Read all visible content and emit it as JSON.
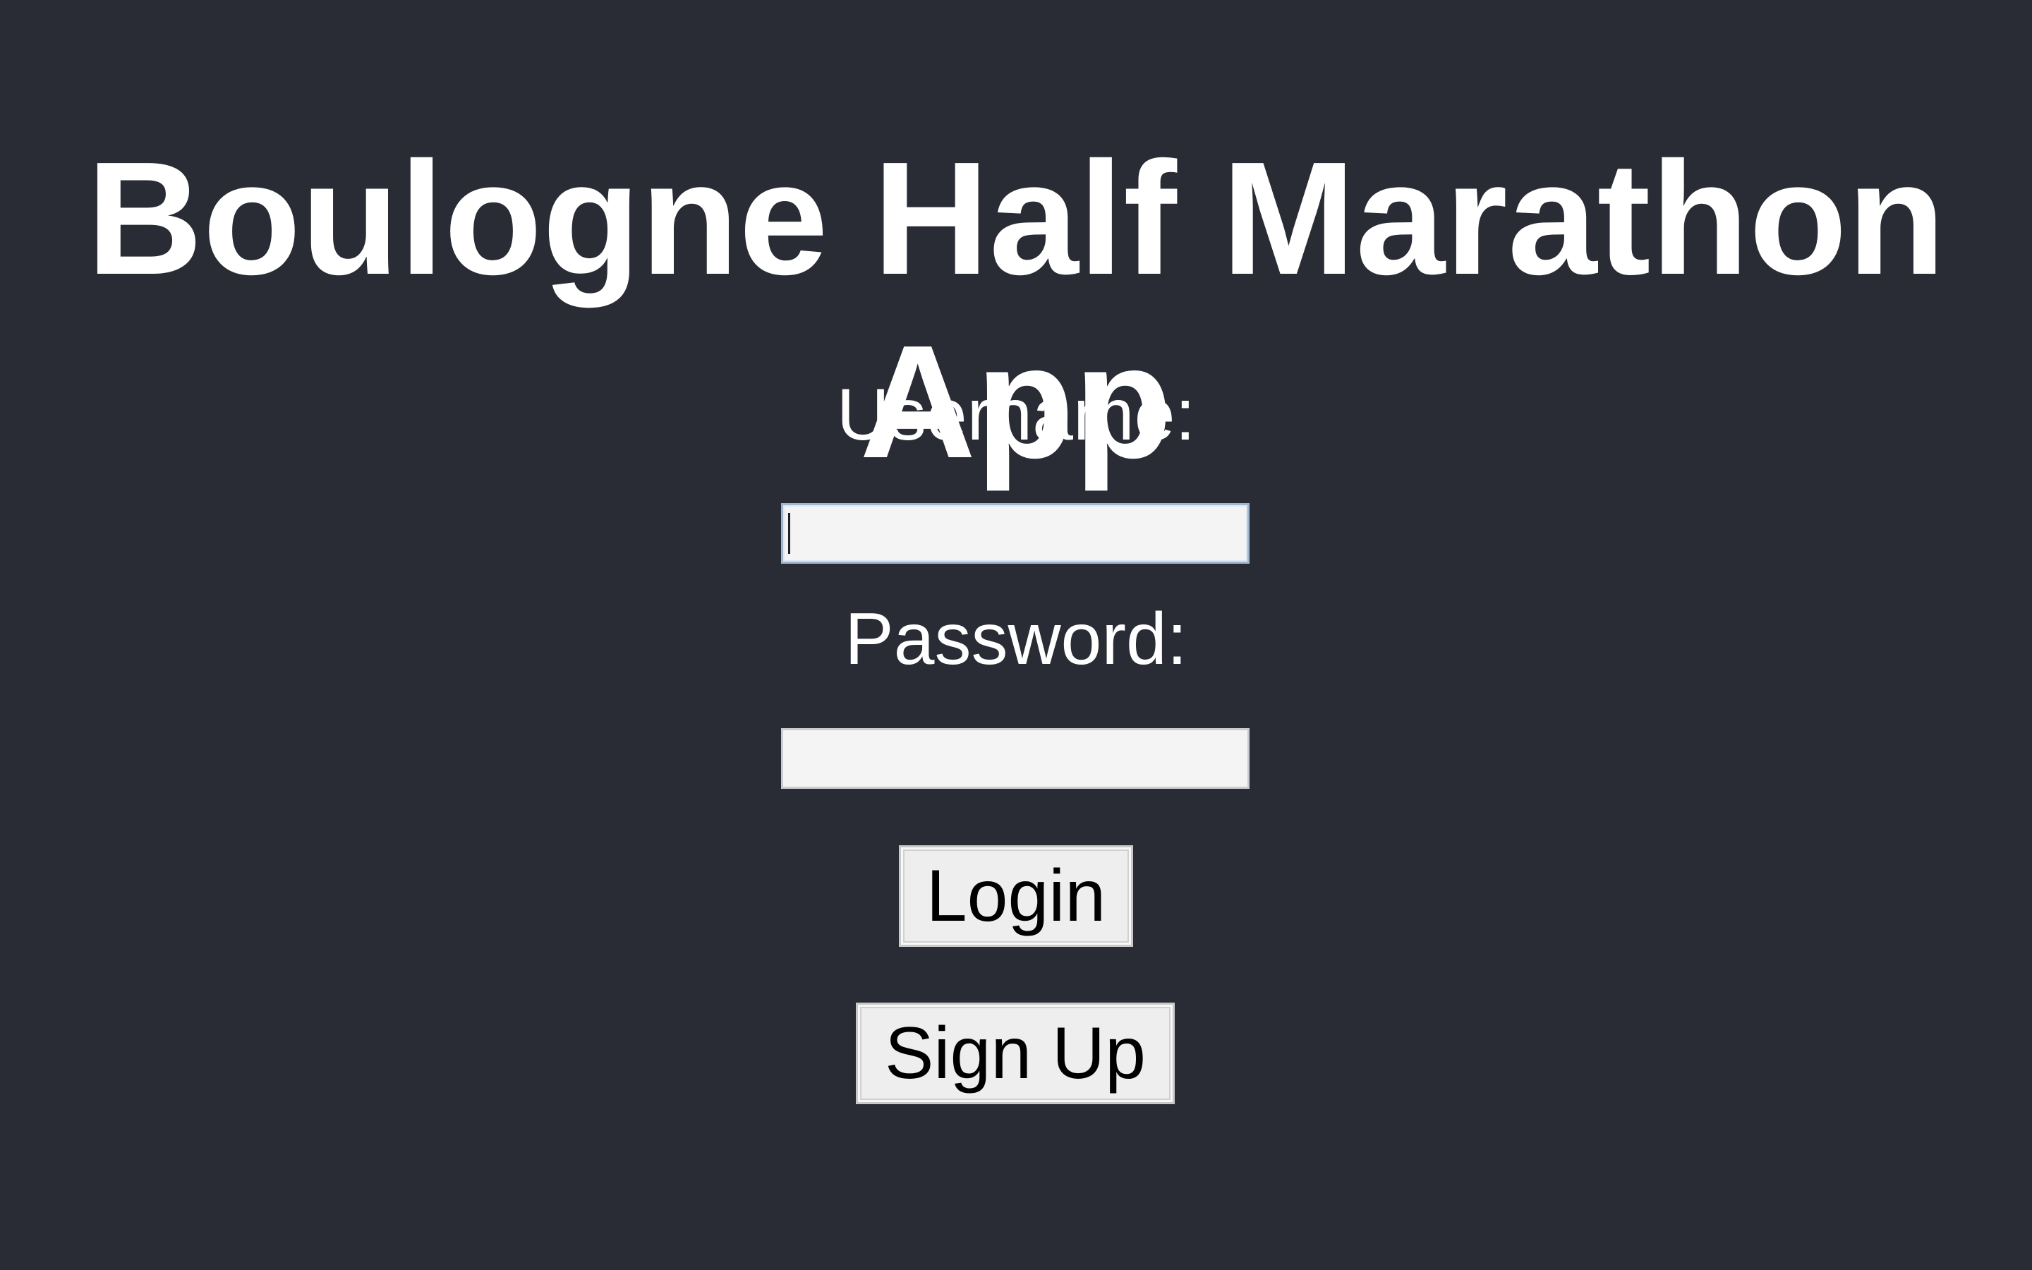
{
  "app": {
    "title": "Boulogne Half Marathon App"
  },
  "form": {
    "username_label": "Username:",
    "username_value": "",
    "password_label": "Password:",
    "password_value": "",
    "login_label": "Login",
    "signup_label": "Sign Up"
  },
  "colors": {
    "background": "#292c34",
    "text": "#ffffff",
    "field_background": "#f4f4f4",
    "button_background": "#eeeeee"
  }
}
